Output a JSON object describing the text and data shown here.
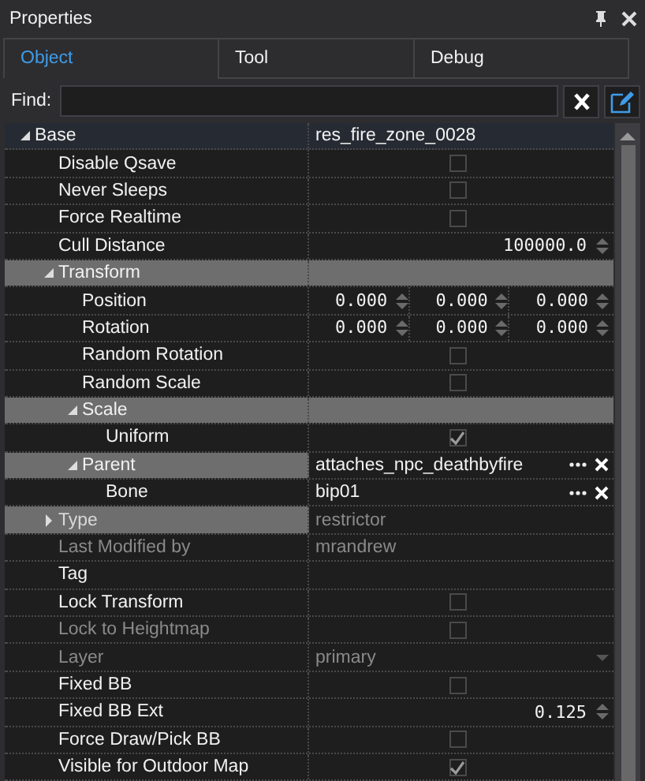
{
  "panel": {
    "title": "Properties"
  },
  "tabs": [
    {
      "label": "Object",
      "selected": true
    },
    {
      "label": "Tool",
      "selected": false
    },
    {
      "label": "Debug",
      "selected": false
    }
  ],
  "find": {
    "label": "Find:"
  },
  "properties": [
    {
      "kind": "category",
      "name": "Base",
      "value": "res_fire_zone_0028",
      "expanded": true,
      "disabled": false,
      "children": [
        {
          "kind": "checkbox",
          "name": "Disable Qsave",
          "checked": false,
          "disabled": false
        },
        {
          "kind": "checkbox",
          "name": "Never Sleeps",
          "checked": false,
          "disabled": false
        },
        {
          "kind": "checkbox",
          "name": "Force Realtime",
          "checked": false,
          "disabled": false
        },
        {
          "kind": "number",
          "name": "Cull Distance",
          "value": "100000.0",
          "disabled": false
        },
        {
          "kind": "group",
          "name": "Transform",
          "expanded": true,
          "disabled": false,
          "children": [
            {
              "kind": "vector",
              "name": "Position",
              "values": [
                "0.000",
                "0.000",
                "0.000"
              ],
              "disabled": false
            },
            {
              "kind": "vector",
              "name": "Rotation",
              "values": [
                "0.000",
                "0.000",
                "0.000"
              ],
              "disabled": false
            },
            {
              "kind": "checkbox",
              "name": "Random Rotation",
              "checked": false,
              "disabled": false
            },
            {
              "kind": "checkbox",
              "name": "Random Scale",
              "checked": false,
              "disabled": false
            },
            {
              "kind": "group",
              "name": "Scale",
              "expanded": true,
              "disabled": false,
              "children": [
                {
                  "kind": "checkbox",
                  "name": "Uniform",
                  "checked": true,
                  "disabled": false
                }
              ]
            },
            {
              "kind": "link",
              "name": "Parent",
              "value": "attaches_npc_deathbyfire",
              "expanded": true,
              "disabled": false,
              "children": [
                {
                  "kind": "link",
                  "name": "Bone",
                  "value": "bip01",
                  "disabled": false
                }
              ]
            }
          ]
        },
        {
          "kind": "text",
          "name": "Type",
          "value": "restrictor",
          "expanded": false,
          "disabled": true
        },
        {
          "kind": "text",
          "name": "Last Modified by",
          "value": "mrandrew",
          "disabled": true
        },
        {
          "kind": "text",
          "name": "Tag",
          "disabled": false
        },
        {
          "kind": "checkbox",
          "name": "Lock Transform",
          "checked": false,
          "disabled": false
        },
        {
          "kind": "checkbox",
          "name": "Lock to Heightmap",
          "checked": false,
          "disabled": true
        },
        {
          "kind": "combo",
          "name": "Layer",
          "value": "primary",
          "disabled": true
        },
        {
          "kind": "checkbox",
          "name": "Fixed BB",
          "checked": false,
          "disabled": false
        },
        {
          "kind": "number",
          "name": "Fixed BB Ext",
          "value": "0.125",
          "disabled": false
        },
        {
          "kind": "checkbox",
          "name": "Force Draw/Pick BB",
          "checked": false,
          "disabled": false
        },
        {
          "kind": "checkbox",
          "name": "Visible for Outdoor Map",
          "checked": true,
          "disabled": false
        }
      ]
    }
  ]
}
